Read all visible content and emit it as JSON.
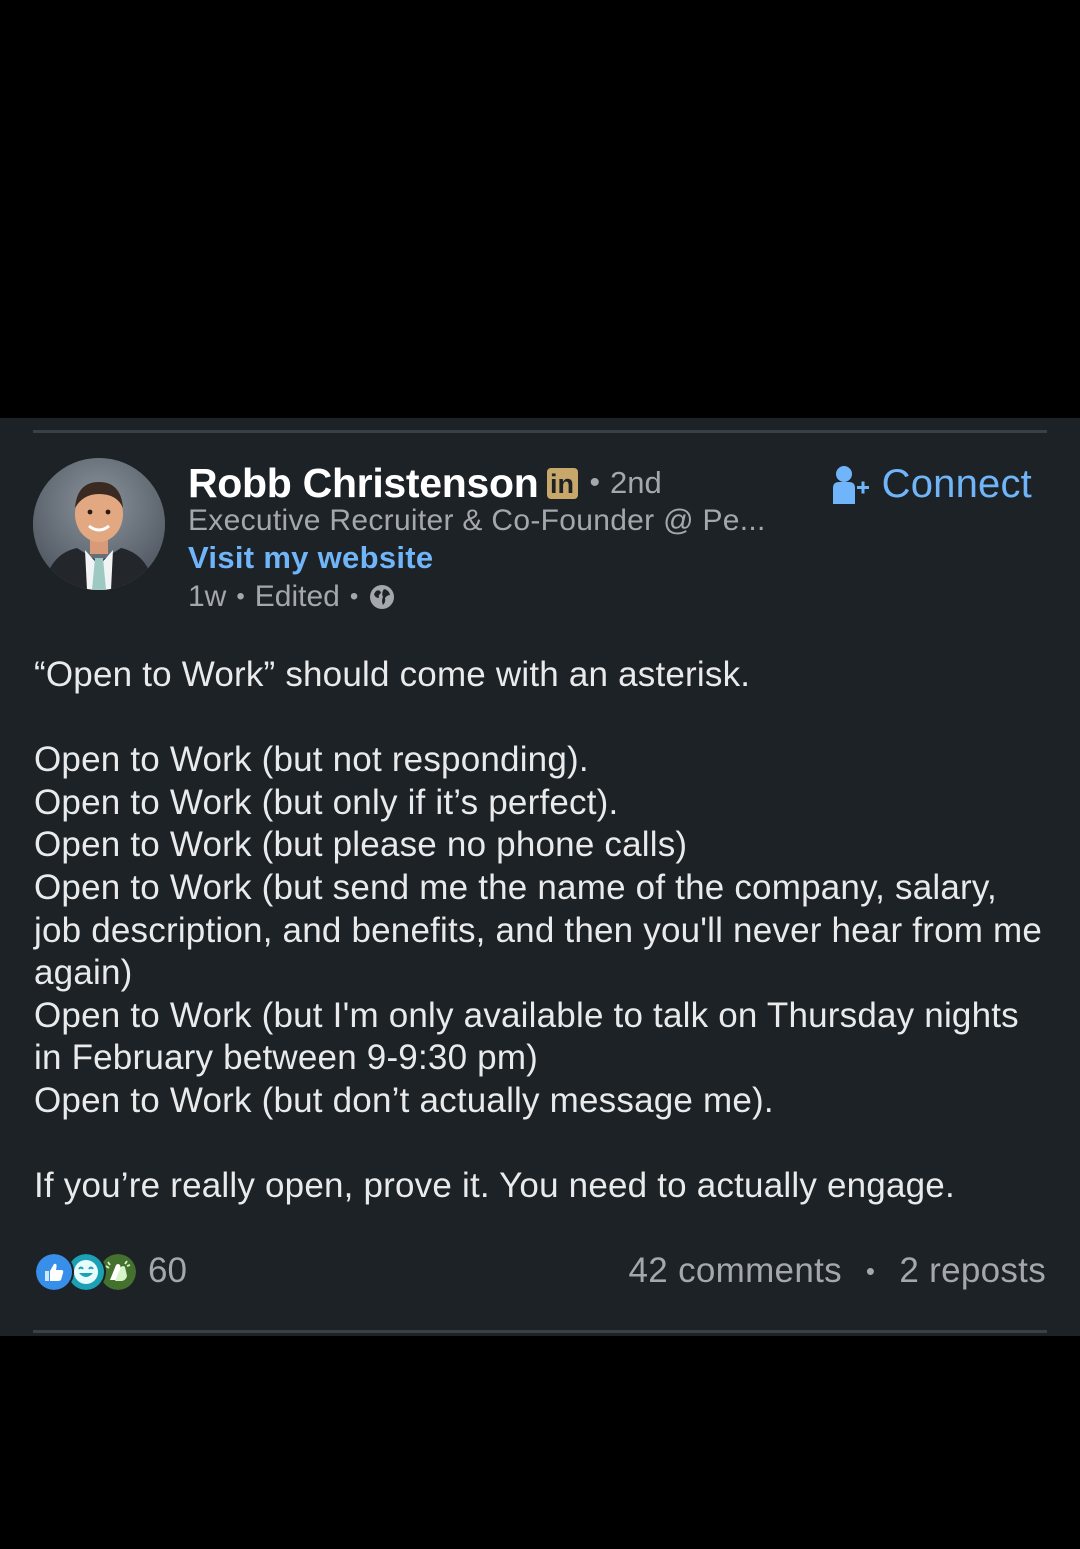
{
  "post": {
    "author": {
      "name": "Robb Christenson",
      "badge": "in",
      "degree": "2nd",
      "headline": "Executive Recruiter & Co-Founder @ Pe...",
      "website_label": "Visit my website"
    },
    "meta": {
      "age": "1w",
      "edited": "Edited",
      "visibility_icon": "globe-icon"
    },
    "connect_label": "Connect",
    "body": {
      "intro": "“Open to Work” should come with an asterisk.",
      "lines": [
        "Open to Work (but not responding).",
        "Open to Work (but only if it’s perfect).",
        "Open to Work (but please no phone calls)",
        "Open to Work (but send me the name of the company, salary, job description, and benefits, and then you'll never hear from me again)",
        "Open to Work (but I'm only available to talk on Thursday nights in February between 9-9:30 pm)",
        "Open to Work (but don’t actually message me)."
      ],
      "closing": "If you’re really open, prove it.  You need to actually engage."
    },
    "social": {
      "reaction_icons": [
        "like-icon",
        "funny-icon",
        "celebrate-icon"
      ],
      "reaction_count": "60",
      "comments": "42 comments",
      "reposts": "2 reposts"
    }
  },
  "colors": {
    "page_background": "#000000",
    "card_background": "#1d2226",
    "accent_blue": "#70b5f9",
    "muted_text": "#a4a8ac",
    "primary_text": "#ffffff"
  }
}
